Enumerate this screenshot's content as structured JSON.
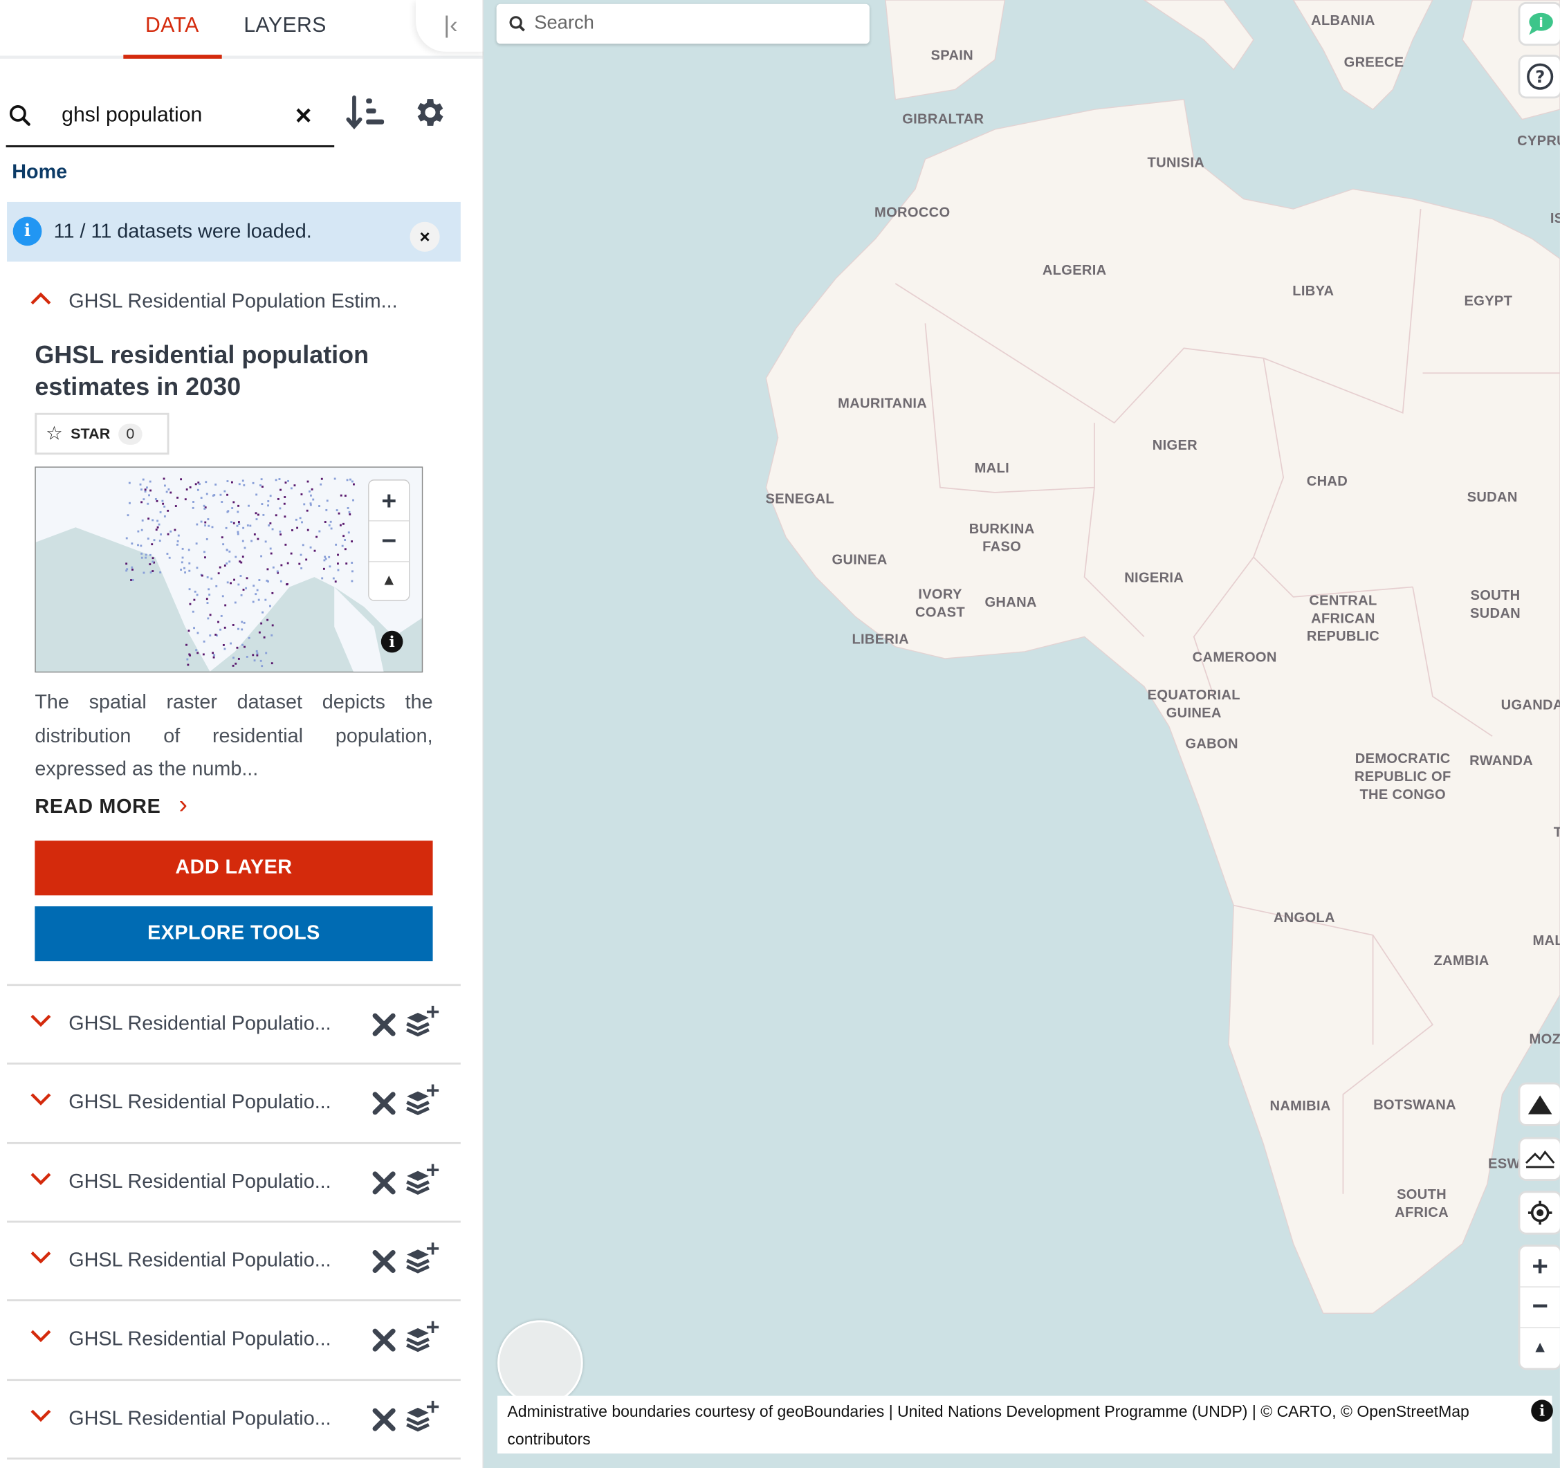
{
  "tabs": [
    {
      "label": "DATA",
      "active": true
    },
    {
      "label": "LAYERS",
      "active": false
    }
  ],
  "search": {
    "value": "ghsl population"
  },
  "breadcrumb": "Home",
  "notice": "11 / 11 datasets were loaded.",
  "expanded": {
    "header": "GHSL Residential Population Estim...",
    "title": "GHSL residential population estimates in 2030",
    "star_label": "STAR",
    "star_count": "0",
    "description": "The spatial raster dataset depicts the distribution of residential population, expressed as the numb...",
    "read_more": "READ MORE",
    "add_layer": "ADD LAYER",
    "explore_tools": "EXPLORE TOOLS"
  },
  "datasets": [
    {
      "label": "GHSL Residential Populatio..."
    },
    {
      "label": "GHSL Residential Populatio..."
    },
    {
      "label": "GHSL Residential Populatio..."
    },
    {
      "label": "GHSL Residential Populatio..."
    },
    {
      "label": "GHSL Residential Populatio..."
    },
    {
      "label": "GHSL Residential Populatio..."
    }
  ],
  "map": {
    "search_placeholder": "Search",
    "countries": [
      "ALBANIA",
      "SPAIN",
      "GREECE",
      "GIBRALTAR",
      "CYPRU",
      "TUNISIA",
      "MOROCCO",
      "IS",
      "ALGERIA",
      "LIBYA",
      "EGYPT",
      "MAURITANIA",
      "NIGER",
      "MALI",
      "CHAD",
      "SENEGAL",
      "SUDAN",
      "BURKINA FASO",
      "GUINEA",
      "NIGERIA",
      "IVORY COAST",
      "GHANA",
      "CENTRAL AFRICAN REPUBLIC",
      "SOUTH SUDAN",
      "LIBERIA",
      "CAMEROON",
      "EQUATORIAL GUINEA",
      "UGANDA",
      "GABON",
      "DEMOCRATIC REPUBLIC OF THE CONGO",
      "RWANDA",
      "T",
      "ANGOLA",
      "ZAMBIA",
      "MAL",
      "MOZ",
      "NAMIBIA",
      "BOTSWANA",
      "ESW",
      "SOUTH AFRICA"
    ],
    "attribution": "Administrative boundaries courtesy of geoBoundaries | United Nations Development Programme (UNDP) | © CARTO, © OpenStreetMap contributors"
  },
  "colors": {
    "accent": "#d42a0c",
    "primary": "#006bb3",
    "navy": "#0b3a66",
    "info": "#2196f3",
    "notice_bg": "#d6e7f5",
    "ocean": "#cde1e4",
    "land": "#f8f4ef"
  }
}
